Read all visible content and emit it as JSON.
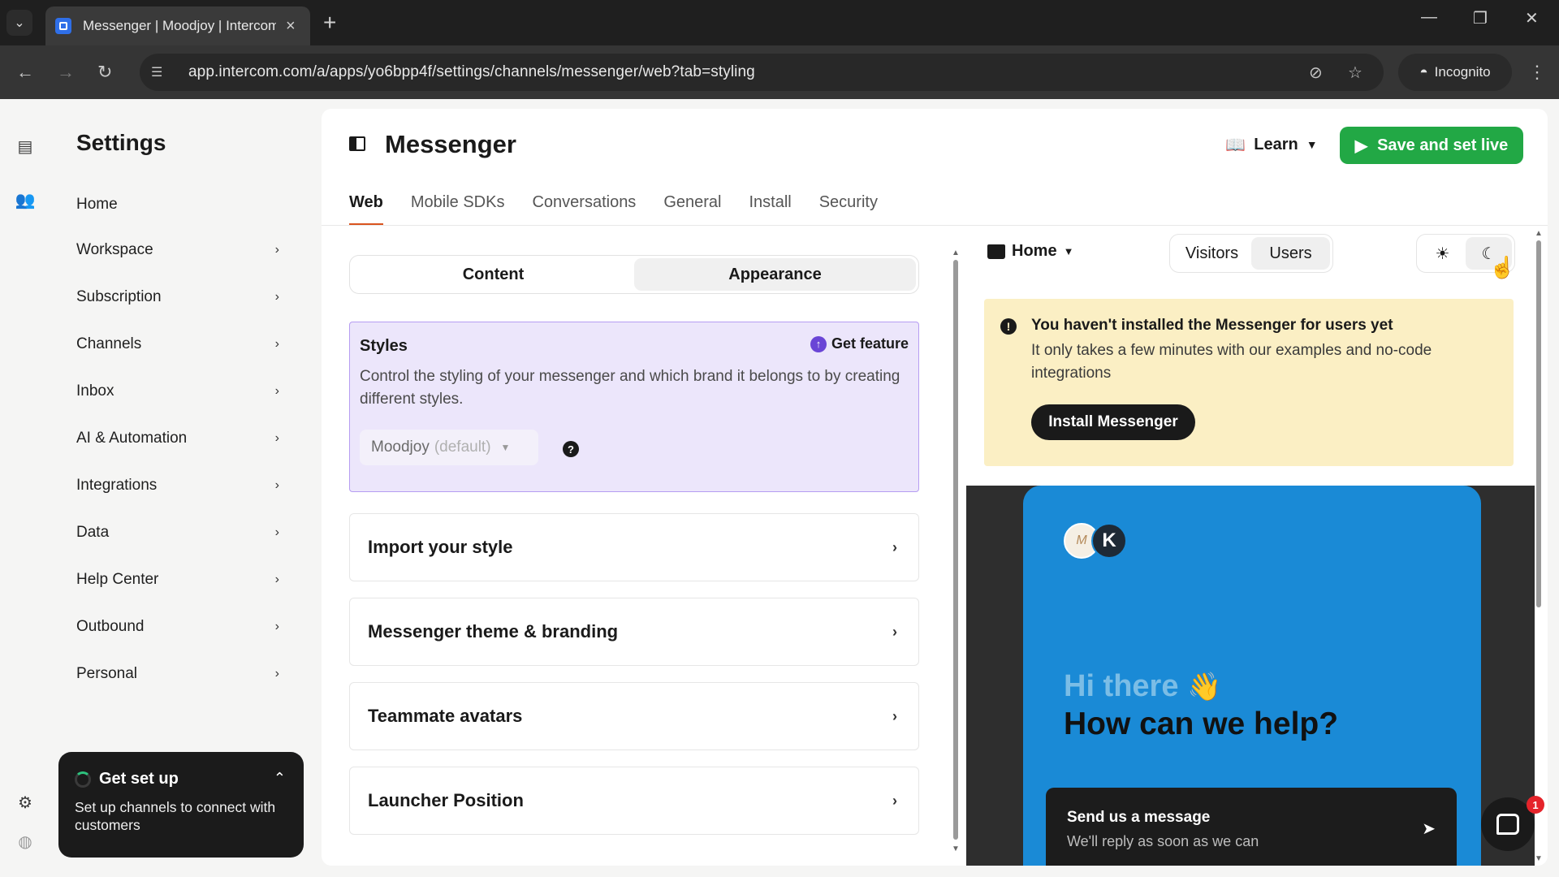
{
  "browser": {
    "tab_title": "Messenger | Moodjoy | Intercom",
    "url": "app.intercom.com/a/apps/yo6bpp4f/settings/channels/messenger/web?tab=styling",
    "incognito_label": "Incognito"
  },
  "sidebar": {
    "title": "Settings",
    "items": [
      {
        "label": "Home",
        "chevron": false
      },
      {
        "label": "Workspace",
        "chevron": true
      },
      {
        "label": "Subscription",
        "chevron": true
      },
      {
        "label": "Channels",
        "chevron": true
      },
      {
        "label": "Inbox",
        "chevron": true
      },
      {
        "label": "AI & Automation",
        "chevron": true
      },
      {
        "label": "Integrations",
        "chevron": true
      },
      {
        "label": "Data",
        "chevron": true
      },
      {
        "label": "Help Center",
        "chevron": true
      },
      {
        "label": "Outbound",
        "chevron": true
      },
      {
        "label": "Personal",
        "chevron": true
      }
    ],
    "get_set_up": {
      "title": "Get set up",
      "text": "Set up channels to connect with customers"
    }
  },
  "header": {
    "title": "Messenger",
    "learn_label": "Learn",
    "save_label": "Save and set live",
    "save_color": "#22a845"
  },
  "tabs": [
    "Web",
    "Mobile SDKs",
    "Conversations",
    "General",
    "Install",
    "Security"
  ],
  "active_tab": "Web",
  "segments": {
    "content": "Content",
    "appearance": "Appearance",
    "selected": "Appearance"
  },
  "styles_panel": {
    "title": "Styles",
    "get_feature_label": "Get feature",
    "description": "Control the styling of your messenger and which brand it belongs to by creating different styles.",
    "style_name": "Moodjoy",
    "style_default": "(default)"
  },
  "accordions": [
    "Import your style",
    "Messenger theme & branding",
    "Teammate avatars",
    "Launcher Position"
  ],
  "preview": {
    "page_dropdown": "Home",
    "audience": {
      "visitors": "Visitors",
      "users": "Users",
      "selected": "Users"
    },
    "theme_selected": "dark",
    "warning": {
      "title": "You haven't installed the Messenger for users yet",
      "text": "It only takes a few minutes with our examples and no-code integrations",
      "button": "Install Messenger"
    },
    "messenger": {
      "avatar_letter": "K",
      "greeting": "Hi there",
      "help": "How can we help?",
      "send_title": "Send us a message",
      "send_sub": "We'll reply as soon as we can",
      "accent_color": "#1a8ad6"
    },
    "launcher_badge": "1"
  }
}
